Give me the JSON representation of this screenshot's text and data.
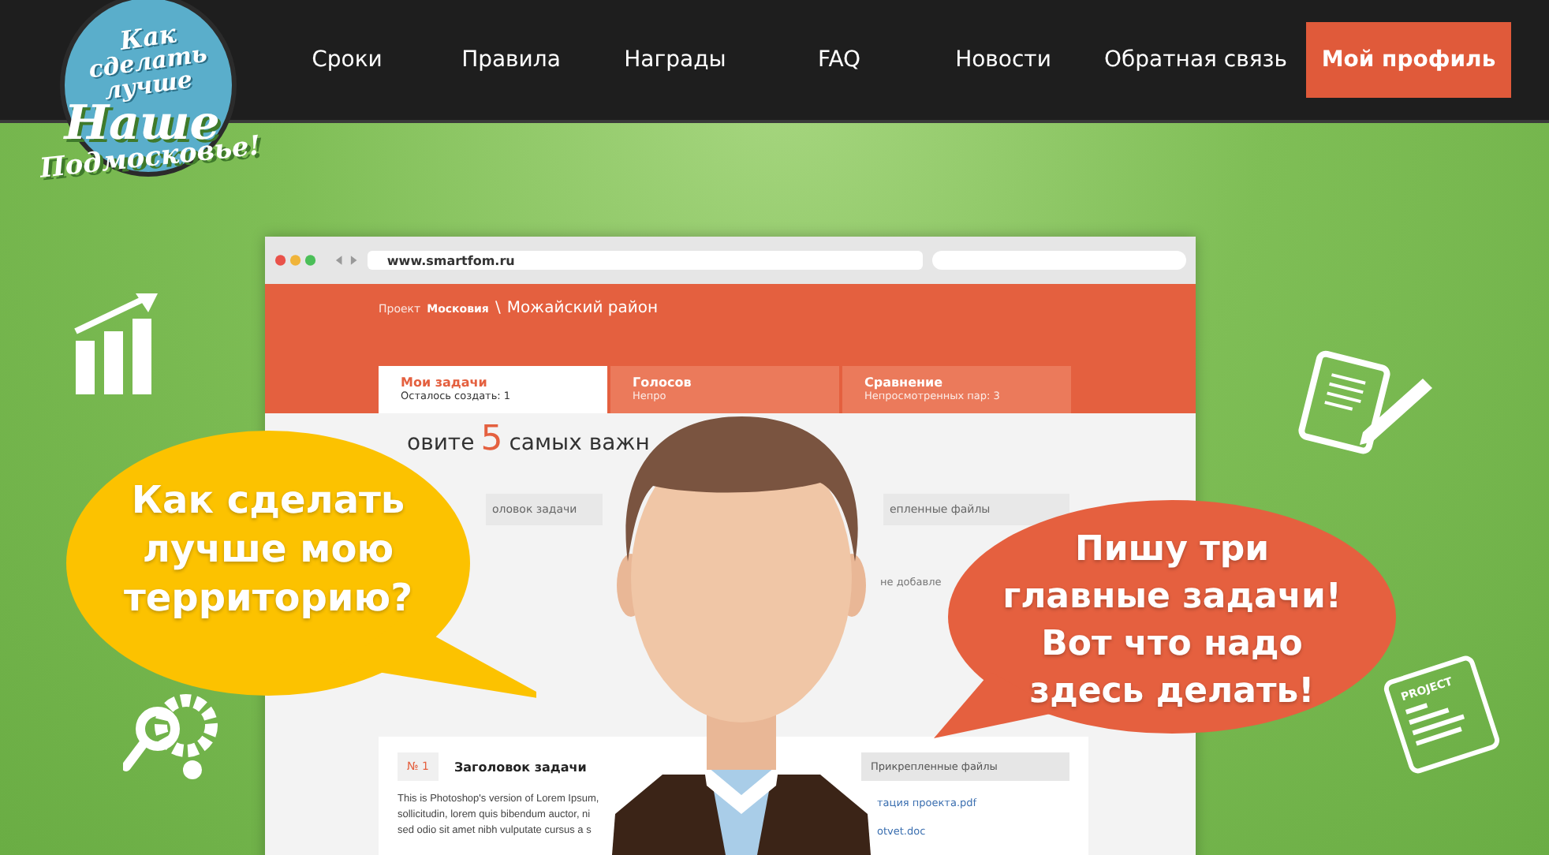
{
  "header": {
    "logo": {
      "lines": [
        "Как",
        "сделать",
        "лучше",
        "Наше",
        "Подмосковье!"
      ]
    },
    "nav": [
      "Сроки",
      "Правила",
      "Награды",
      "FAQ",
      "Новости",
      "Обратная связь"
    ],
    "profile_button": "Мой профиль"
  },
  "mockup": {
    "url": "www.smartfom.ru",
    "breadcrumb": {
      "prefix": "Проект",
      "project": "Московия",
      "separator": "\\",
      "district": "Можайский район"
    },
    "tabs": [
      {
        "title": "Мои задачи",
        "subtitle": "Осталось создать: 1",
        "selected": true
      },
      {
        "title": "Голосов",
        "subtitle": "Непро",
        "selected": false
      },
      {
        "title": "Сравнение",
        "subtitle": "Непросмотренных пар: 3",
        "selected": false
      }
    ],
    "heading": {
      "before": "овите",
      "number": "5",
      "after": "самых важн"
    },
    "fields": [
      "оловок задачи",
      "епленные файлы"
    ],
    "note": "не добавле",
    "task_card": {
      "number": "№ 1",
      "title": "Заголовок задачи",
      "text_lines": [
        "This is Photoshop's version  of Lorem Ipsum,",
        "sollicitudin, lorem quis bibendum auctor, ni",
        "sed odio sit amet nibh vulputate cursus a s"
      ],
      "files_title": "Прикрепленные файлы",
      "files": [
        "тация проекта.pdf",
        "otvet.doc"
      ]
    }
  },
  "speech_bubbles": [
    {
      "lines": [
        "Как сделать",
        "лучше мою",
        "территорию?"
      ],
      "color": "#fcc200"
    },
    {
      "lines": [
        "Пишу три",
        "главные задачи!",
        "Вот что надо",
        "здесь делать!"
      ],
      "color": "#e5603f"
    }
  ],
  "project_icon": {
    "label": "PROJECT"
  }
}
